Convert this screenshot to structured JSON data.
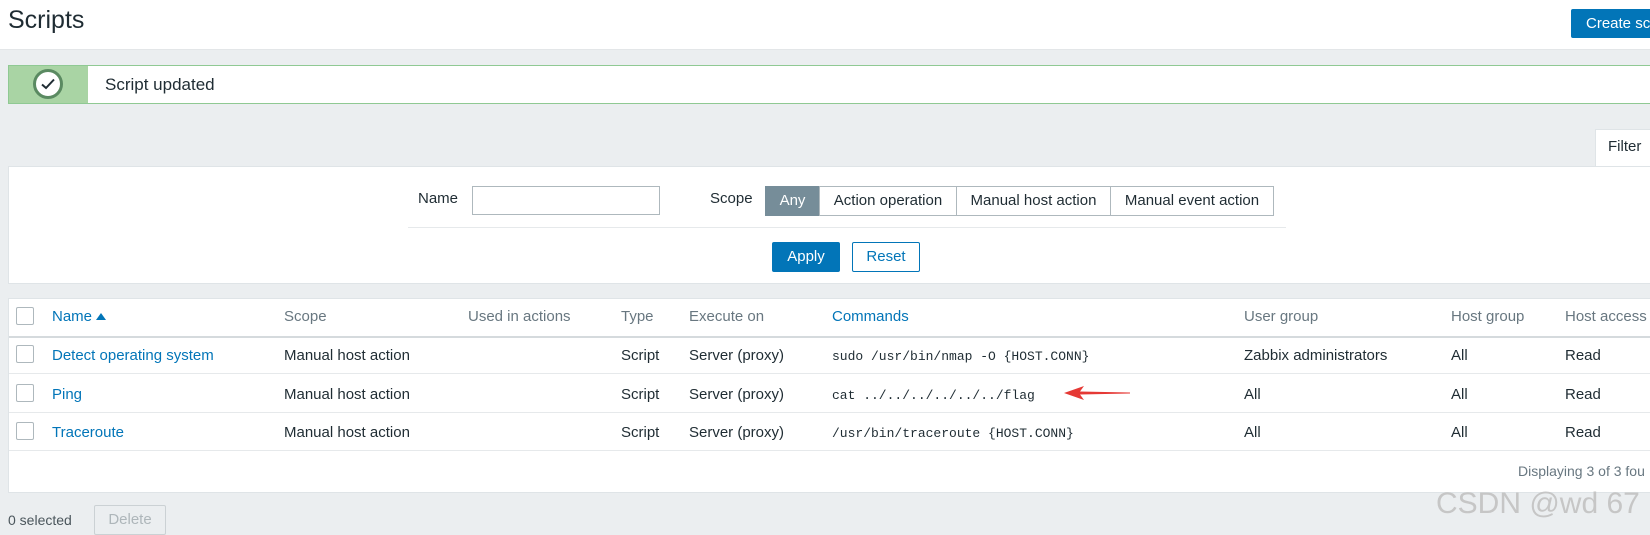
{
  "header": {
    "title": "Scripts",
    "create_button": "Create sc"
  },
  "message": {
    "icon": "check-circle-icon",
    "text": "Script updated"
  },
  "filter": {
    "tab_label": "Filter",
    "name_label": "Name",
    "name_value": "",
    "scope_label": "Scope",
    "scope_options": [
      "Any",
      "Action operation",
      "Manual host action",
      "Manual event action"
    ],
    "scope_selected": "Any",
    "apply": "Apply",
    "reset": "Reset"
  },
  "table": {
    "columns": [
      "Name",
      "Scope",
      "Used in actions",
      "Type",
      "Execute on",
      "Commands",
      "User group",
      "Host group",
      "Host access"
    ],
    "sorted_by": "Name",
    "rows": [
      {
        "name": "Detect operating system",
        "scope": "Manual host action",
        "used": "",
        "type": "Script",
        "execute_on": "Server (proxy)",
        "commands": "sudo /usr/bin/nmap -O {HOST.CONN}",
        "user_group": "Zabbix administrators",
        "host_group": "All",
        "host_access": "Read"
      },
      {
        "name": "Ping",
        "scope": "Manual host action",
        "used": "",
        "type": "Script",
        "execute_on": "Server (proxy)",
        "commands": "cat ../../../../../../flag",
        "user_group": "All",
        "host_group": "All",
        "host_access": "Read"
      },
      {
        "name": "Traceroute",
        "scope": "Manual host action",
        "used": "",
        "type": "Script",
        "execute_on": "Server (proxy)",
        "commands": "/usr/bin/traceroute {HOST.CONN}",
        "user_group": "All",
        "host_group": "All",
        "host_access": "Read"
      }
    ],
    "footer": "Displaying 3 of 3 fou"
  },
  "bottom": {
    "selected": "0 selected",
    "delete": "Delete"
  },
  "watermark": "CSDN @wd 67",
  "colors": {
    "accent": "#0275b8",
    "success": "#a9d4a4",
    "arrow": "#e53935"
  }
}
